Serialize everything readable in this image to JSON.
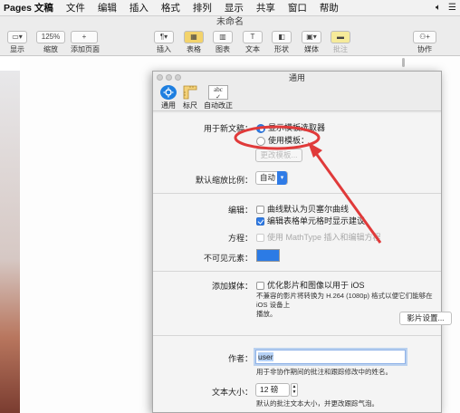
{
  "menubar": {
    "app": "Pages 文稿",
    "items": [
      "文件",
      "编辑",
      "插入",
      "格式",
      "排列",
      "显示",
      "共享",
      "窗口",
      "帮助"
    ]
  },
  "window": {
    "title": "未命名"
  },
  "toolbar": {
    "view_label": "显示",
    "zoom_value": "125%",
    "zoom_label": "缩放",
    "add_page_label": "添加页面",
    "insert_label": "插入",
    "table_label": "表格",
    "chart_label": "图表",
    "text_label": "文本",
    "shape_label": "形状",
    "media_label": "媒体",
    "comment_label": "批注",
    "collaborate_label": "协作"
  },
  "prefs": {
    "title": "通用",
    "tabs": [
      {
        "label": "通用"
      },
      {
        "label": "标尺"
      },
      {
        "label": "自动改正"
      }
    ],
    "new_doc_label": "用于新文稿：",
    "opt_chooser": "显示模板选取器",
    "opt_template": "使用模板：",
    "change_template_btn": "更改模板...",
    "zoom_label": "默认缩放比例：",
    "zoom_value": "自动",
    "edit_label": "编辑：",
    "edit_opt1": "曲线默认为贝塞尔曲线",
    "edit_opt2": "编辑表格单元格时显示建议",
    "equation_label": "方程：",
    "equation_opt": "使用 MathType 插入和编辑方程",
    "invisibles_label": "不可见元素：",
    "media_label": "添加媒体：",
    "media_opt": "优化影片和图像以用于 iOS",
    "media_note_1": "不兼容的影片将转换为 H.264 (1080p) 格式以便它们能够在 iOS 设备上",
    "media_note_2": "播放。",
    "movie_settings_btn": "影片设置...",
    "author_label": "作者：",
    "author_value": "user",
    "author_note": "用于非协作期间的批注和跟踪修改中的姓名。",
    "text_size_label": "文本大小：",
    "text_size_value": "12 磅",
    "text_size_note": "默认的批注文本大小，并更改跟踪气泡。"
  },
  "annotation_color": "#e03a3a",
  "accent_color": "#2f7be6"
}
